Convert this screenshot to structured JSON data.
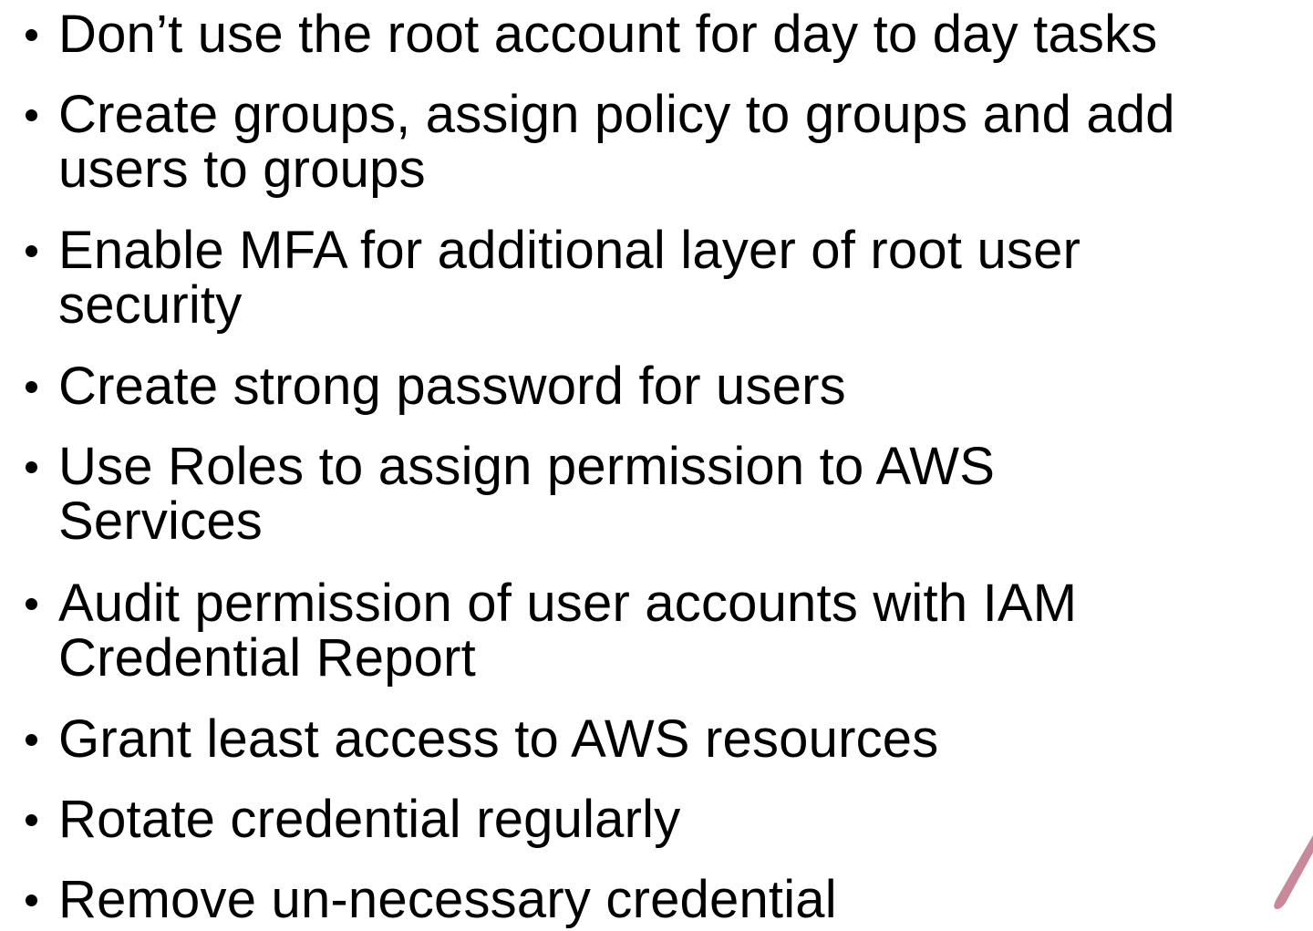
{
  "bullets": [
    "Don’t use the root account for day to day tasks",
    "Create groups, assign policy to groups and add users to groups",
    "Enable MFA for additional layer of root user security",
    "Create strong password for users",
    "Use Roles to assign permission to AWS Services",
    "Audit permission of user accounts with IAM Credential Report",
    "Grant least access to AWS resources",
    "Rotate credential regularly",
    "Remove un-necessary credential"
  ],
  "colors": {
    "text": "#000000",
    "background": "#ffffff",
    "accent": "#c88a9b"
  }
}
